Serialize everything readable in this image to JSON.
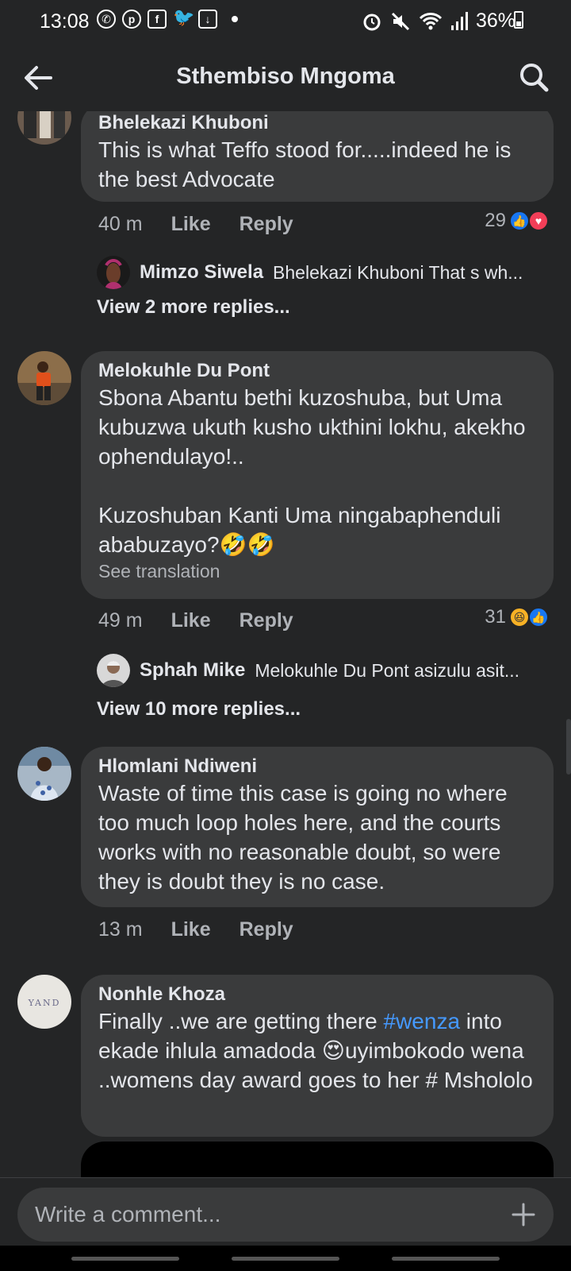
{
  "status_bar": {
    "time": "13:08",
    "battery": "36%"
  },
  "header": {
    "title": "Sthembiso Mngoma"
  },
  "comments": [
    {
      "author": "Bhelekazi Khuboni",
      "text": "This is what Teffo stood for.....indeed he is the best Advocate",
      "time": "40 m",
      "like": "Like",
      "reply": "Reply",
      "reaction_count": "29",
      "reply_preview": {
        "author": "Mimzo Siwela",
        "snippet": "Bhelekazi Khuboni That s wh..."
      },
      "more_replies": "View 2 more replies..."
    },
    {
      "author": "Melokuhle Du Pont",
      "text": "Sbona Abantu bethi kuzoshuba, but Uma kubuzwa ukuth kusho ukthini lokhu, akekho ophendulayo!..\n\nKuzoshuban Kanti Uma ningabaphenduli ababuzayo?🤣🤣",
      "see_translation": "See translation",
      "time": "49 m",
      "like": "Like",
      "reply": "Reply",
      "reaction_count": "31",
      "reply_preview": {
        "author": "Sphah Mike",
        "snippet": "Melokuhle Du Pont asizulu asit..."
      },
      "more_replies": "View 10 more replies..."
    },
    {
      "author": "Hlomlani Ndiweni",
      "text": "Waste of time this case is going no where too much loop holes here, and the courts works with no reasonable doubt, so were they is doubt they is no case.",
      "time": "13 m",
      "like": "Like",
      "reply": "Reply"
    },
    {
      "author": "Nonhle Khoza",
      "text_before": "Finally ..we are getting there ",
      "hashtag": "#wenza",
      "text_after": " into ekade ihlula amadoda 😍uyimbokodo wena ..womens day award goes to her # Msholol​o"
    }
  ],
  "composer": {
    "placeholder": "Write a comment..."
  },
  "colors": {
    "background": "#242526",
    "bubble": "#3a3b3c",
    "link": "#4599ff",
    "like": "#1877f2",
    "love": "#f33e58"
  }
}
